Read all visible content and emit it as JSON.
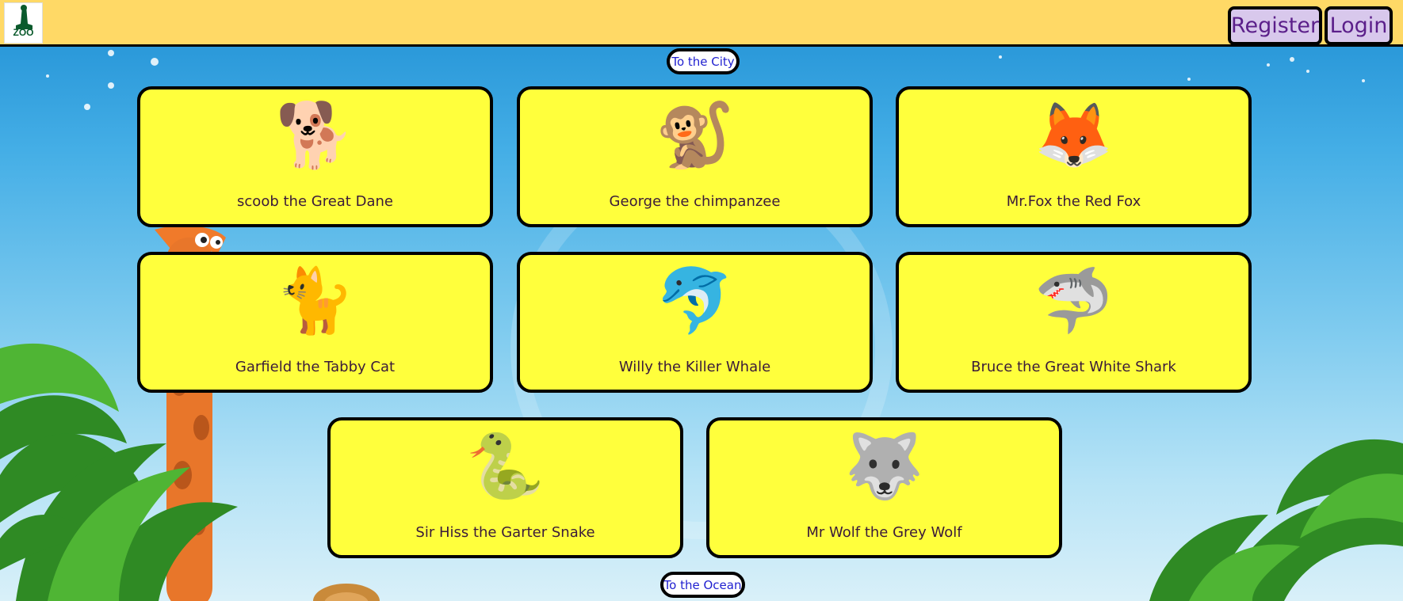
{
  "header": {
    "logo_text": "ZOO",
    "register_label": "Register",
    "login_label": "Login"
  },
  "nav": {
    "to_city": "To the City",
    "to_ocean": "To the Ocean"
  },
  "animals": [
    {
      "name": "scoob the Great Dane",
      "emoji": "🐕"
    },
    {
      "name": "George the chimpanzee",
      "emoji": "🐒"
    },
    {
      "name": "Mr.Fox the Red Fox",
      "emoji": "🦊"
    },
    {
      "name": "Garfield the Tabby Cat",
      "emoji": "🐈"
    },
    {
      "name": "Willy the Killer Whale",
      "emoji": "🐬"
    },
    {
      "name": "Bruce the Great White Shark",
      "emoji": "🦈"
    },
    {
      "name": "Sir Hiss the Garter Snake",
      "emoji": "🐍"
    },
    {
      "name": "Mr Wolf the Grey Wolf",
      "emoji": "🐺"
    }
  ],
  "colors": {
    "header_bg": "#ffd966",
    "card_bg": "#ffff3c",
    "button_bg": "#d8c8ec",
    "button_text": "#5b1f8a",
    "pill_text": "#1f1fd0",
    "card_text": "#3a1a3a"
  }
}
